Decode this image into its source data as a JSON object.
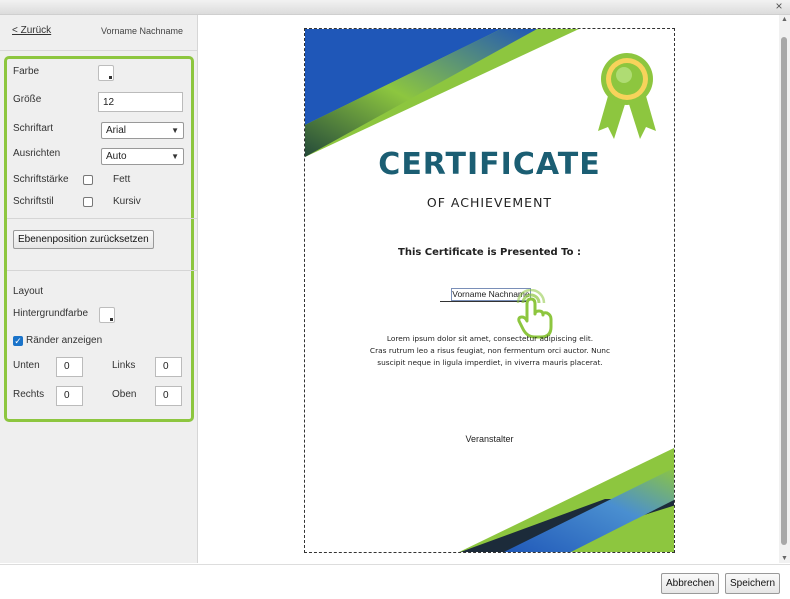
{
  "window": {
    "close_glyph": "×"
  },
  "sidebar": {
    "back_link": "< Zurück",
    "document_name": "Vorname Nachname",
    "text_style": {
      "color_label": "Farbe",
      "size_label": "Größe",
      "size_value": "12",
      "font_label": "Schriftart",
      "font_value": "Arial",
      "align_label": "Ausrichten",
      "align_value": "Auto",
      "weight_label": "Schriftstärke",
      "weight_option": "Fett",
      "weight_checked": false,
      "style_label": "Schriftstil",
      "style_option": "Kursiv",
      "style_checked": false
    },
    "reset_layer_button": "Ebenenposition zurücksetzen",
    "layout": {
      "heading": "Layout",
      "background_label": "Hintergrundfarbe",
      "show_borders_label": "Ränder anzeigen",
      "show_borders_checked": true,
      "bottom_label": "Unten",
      "bottom_value": "0",
      "left_label": "Links",
      "left_value": "0",
      "right_label": "Rechts",
      "right_value": "0",
      "top_label": "Oben",
      "top_value": "0"
    }
  },
  "certificate": {
    "title": "CERTIFICATE",
    "subtitle": "OF ACHIEVEMENT",
    "presented_to": "This Certificate is Presented To :",
    "name_field": "Vorname Nachname",
    "body_line1": "Lorem ipsum dolor sit amet, consectetur adipiscing elit.",
    "body_line2": "Cras rutrum leo a risus feugiat, non fermentum orci auctor. Nunc",
    "body_line3": "suscipit neque in ligula imperdiet, in viverra mauris placerat.",
    "organizer": "Veranstalter"
  },
  "footer": {
    "cancel_button": "Abbrechen",
    "save_button": "Speichern"
  },
  "colors": {
    "accent_green": "#8dc63f",
    "title_teal": "#1b5e73",
    "cert_blue": "#1f57b8",
    "checkbox_blue": "#1a73c9"
  },
  "icons": {
    "award": "award-ribbon-icon",
    "cursor": "tap-hand-cursor-icon",
    "close": "close-icon"
  }
}
